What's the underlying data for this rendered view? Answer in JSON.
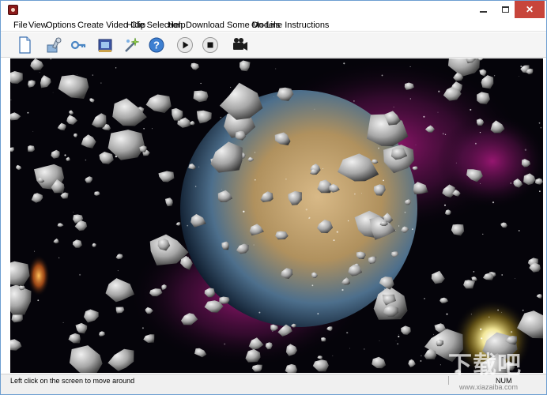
{
  "window": {
    "controls": {
      "minimize": "minimize",
      "maximize": "maximize",
      "close": "close"
    }
  },
  "menubar": {
    "items": [
      {
        "label": "File"
      },
      {
        "label": "View"
      },
      {
        "label": "Options"
      },
      {
        "label": "Create Video Clip"
      },
      {
        "label": "Hide Selection"
      },
      {
        "label": "Help"
      },
      {
        "label": "Download Some Models"
      },
      {
        "label": "On-Line Instructions"
      }
    ]
  },
  "toolbar": {
    "buttons": [
      {
        "icon": "new-document-icon"
      },
      {
        "icon": "tools-icon"
      },
      {
        "icon": "key-icon"
      },
      {
        "icon": "movie-icon"
      },
      {
        "icon": "magic-wand-icon"
      },
      {
        "icon": "help-icon"
      },
      {
        "icon": "play-icon"
      },
      {
        "icon": "stop-icon"
      },
      {
        "icon": "camera-icon"
      }
    ]
  },
  "scene": {
    "description_icon": "asteroid-field-scene",
    "colors": {
      "space": "#05040a",
      "planet": "#b59563",
      "nebula": "#8a1a6e",
      "sun": "#fff7b0"
    }
  },
  "statusbar": {
    "message": "Left click on the screen to move around",
    "num_indicator": "NUM"
  },
  "watermark": {
    "text": "下载吧",
    "subtext": "www.xiazaiba.com"
  }
}
